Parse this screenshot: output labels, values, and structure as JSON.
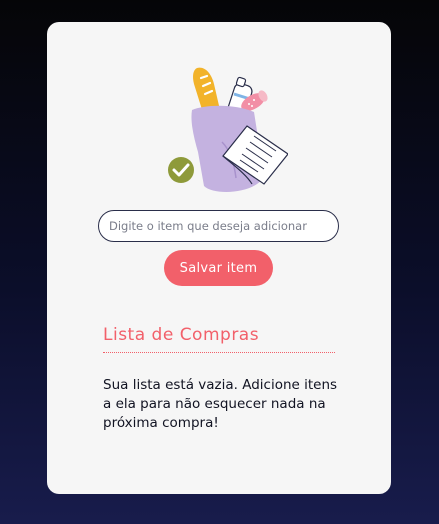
{
  "form": {
    "item_placeholder": "Digite o item que deseja adicionar",
    "save_label": "Salvar item"
  },
  "list": {
    "title": "Lista de Compras",
    "empty_message": "Sua lista está vazia. Adicione itens a ela para não esquecer nada na próxima compra!"
  },
  "icons": {
    "illustration": "grocery-bag-illustration",
    "check": "check-circle-icon"
  },
  "colors": {
    "accent": "#f2606a",
    "bag": "#c4b2e0",
    "check": "#8e9a3a",
    "bread": "#f2b32a",
    "card": "#f6f6f6"
  }
}
